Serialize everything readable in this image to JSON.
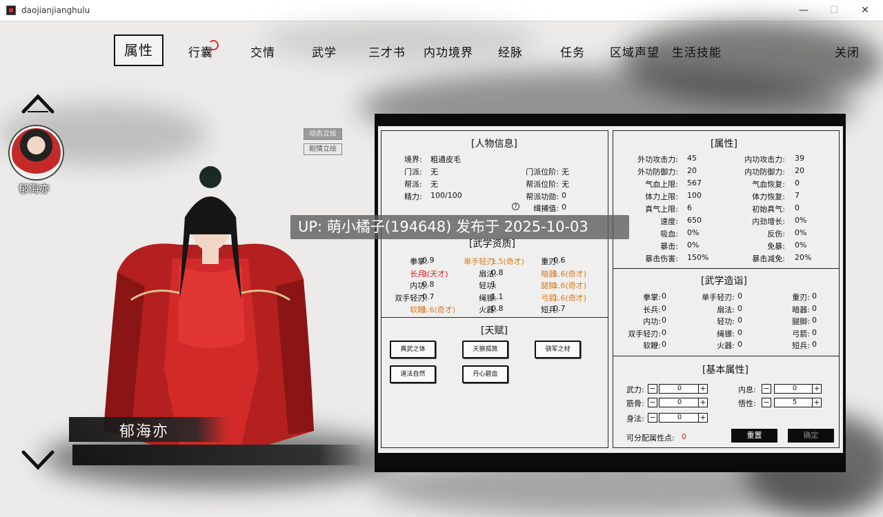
{
  "window": {
    "title": "daojianjianghulu",
    "min": "—",
    "max": "☐",
    "close": "✕"
  },
  "nav": {
    "active": "属性",
    "items": [
      "行囊",
      "交情",
      "武学",
      "三才书",
      "内功境界",
      "经脉",
      "任务",
      "区域声望",
      "生活技能"
    ],
    "close": "关闭"
  },
  "portrait": {
    "avatar_name": "郁海亦",
    "char_name": "郁海亦",
    "btn_dynamic": "动态立绘",
    "btn_story": "剧情立绘"
  },
  "info": {
    "title": "[人物信息]",
    "rows": [
      {
        "k": "境界:",
        "v": "粗通皮毛"
      },
      {
        "k": "门派:",
        "v": "无"
      },
      {
        "k": "帮派:",
        "v": "无"
      },
      {
        "k": "精力:",
        "v": "100/100"
      }
    ],
    "right_rows": [
      {
        "k": "门派位阶:",
        "v": "无"
      },
      {
        "k": "帮派位阶:",
        "v": "无"
      },
      {
        "k": "帮派功勋:",
        "v": "0"
      },
      {
        "k": "缉捕值:",
        "v": "0"
      }
    ],
    "help": "?"
  },
  "aptitude": {
    "title": "[武学资质]",
    "rows": [
      [
        {
          "k": "拳掌:",
          "v": "0.9",
          "c": ""
        },
        {
          "k": "单手轻刃:",
          "v": "1.5(奇才)",
          "c": "orange"
        },
        {
          "k": "重刃:",
          "v": "0.6",
          "c": ""
        }
      ],
      [
        {
          "k": "长兵:",
          "v": "3(天才)",
          "c": "red"
        },
        {
          "k": "扇法:",
          "v": "0.8",
          "c": ""
        },
        {
          "k": "暗器:",
          "v": "1.6(奇才)",
          "c": "orange"
        }
      ],
      [
        {
          "k": "内功:",
          "v": "0.8",
          "c": ""
        },
        {
          "k": "轻功:",
          "v": "1",
          "c": ""
        },
        {
          "k": "腿脚:",
          "v": "1.6(奇才)",
          "c": "orange"
        }
      ],
      [
        {
          "k": "双手轻刃:",
          "v": "0.7",
          "c": ""
        },
        {
          "k": "绳镖:",
          "v": "1.1",
          "c": ""
        },
        {
          "k": "弓箭:",
          "v": "1.6(奇才)",
          "c": "orange"
        }
      ],
      [
        {
          "k": "软鞭:",
          "v": "1.6(奇才)",
          "c": "orange"
        },
        {
          "k": "火器:",
          "v": "0.8",
          "c": ""
        },
        {
          "k": "短兵:",
          "v": "0.7",
          "c": ""
        }
      ]
    ]
  },
  "talent": {
    "title": "[天赋]",
    "items": [
      "真武之体",
      "天狼孤煞",
      "骁军之材",
      "道法自然",
      "丹心碧血"
    ]
  },
  "attr": {
    "title": "[属性]",
    "rows": [
      [
        {
          "k": "外功攻击力:",
          "v": "45"
        },
        {
          "k": "内功攻击力:",
          "v": "39"
        }
      ],
      [
        {
          "k": "外功防御力:",
          "v": "20"
        },
        {
          "k": "内功防御力:",
          "v": "20"
        }
      ],
      [
        {
          "k": "气血上限:",
          "v": "567"
        },
        {
          "k": "气血恢复:",
          "v": "0"
        }
      ],
      [
        {
          "k": "体力上限:",
          "v": "100"
        },
        {
          "k": "体力恢复:",
          "v": "7"
        }
      ],
      [
        {
          "k": "真气上限:",
          "v": "6"
        },
        {
          "k": "初始真气:",
          "v": "0"
        }
      ],
      [
        {
          "k": "速度:",
          "v": "650"
        },
        {
          "k": "内劲增长:",
          "v": "0%"
        }
      ],
      [
        {
          "k": "吸血:",
          "v": "0%"
        },
        {
          "k": "反伤:",
          "v": "0%"
        }
      ],
      [
        {
          "k": "暴击:",
          "v": "0%"
        },
        {
          "k": "免暴:",
          "v": "0%"
        }
      ],
      [
        {
          "k": "暴击伤害:",
          "v": "150%"
        },
        {
          "k": "暴击减免:",
          "v": "20%"
        }
      ]
    ]
  },
  "mastery": {
    "title": "[武学造诣]",
    "rows": [
      [
        {
          "k": "拳掌:",
          "v": "0"
        },
        {
          "k": "单手轻刃:",
          "v": "0"
        },
        {
          "k": "重刃:",
          "v": "0"
        }
      ],
      [
        {
          "k": "长兵:",
          "v": "0"
        },
        {
          "k": "扇法:",
          "v": "0"
        },
        {
          "k": "暗器:",
          "v": "0"
        }
      ],
      [
        {
          "k": "内功:",
          "v": "0"
        },
        {
          "k": "轻功:",
          "v": "0"
        },
        {
          "k": "腿脚:",
          "v": "0"
        }
      ],
      [
        {
          "k": "双手轻刃:",
          "v": "0"
        },
        {
          "k": "绳镖:",
          "v": "0"
        },
        {
          "k": "弓箭:",
          "v": "0"
        }
      ],
      [
        {
          "k": "软鞭:",
          "v": "0"
        },
        {
          "k": "火器:",
          "v": "0"
        },
        {
          "k": "短兵:",
          "v": "0"
        }
      ]
    ]
  },
  "base": {
    "title": "[基本属性]",
    "wuli": {
      "k": "武力:",
      "v": "0"
    },
    "neixi": {
      "k": "内息:",
      "v": "0"
    },
    "jingu": {
      "k": "筋骨:",
      "v": "0"
    },
    "wuxing": {
      "k": "悟性:",
      "v": "5"
    },
    "shenfa": {
      "k": "身法:",
      "v": "0"
    },
    "points_label": "可分配属性点:",
    "points": "0",
    "minus": "−",
    "plus": "+",
    "reset": "重置",
    "confirm": "确定"
  },
  "watermark": "UP: 萌小橘子(194648) 发布于 2025-10-03"
}
